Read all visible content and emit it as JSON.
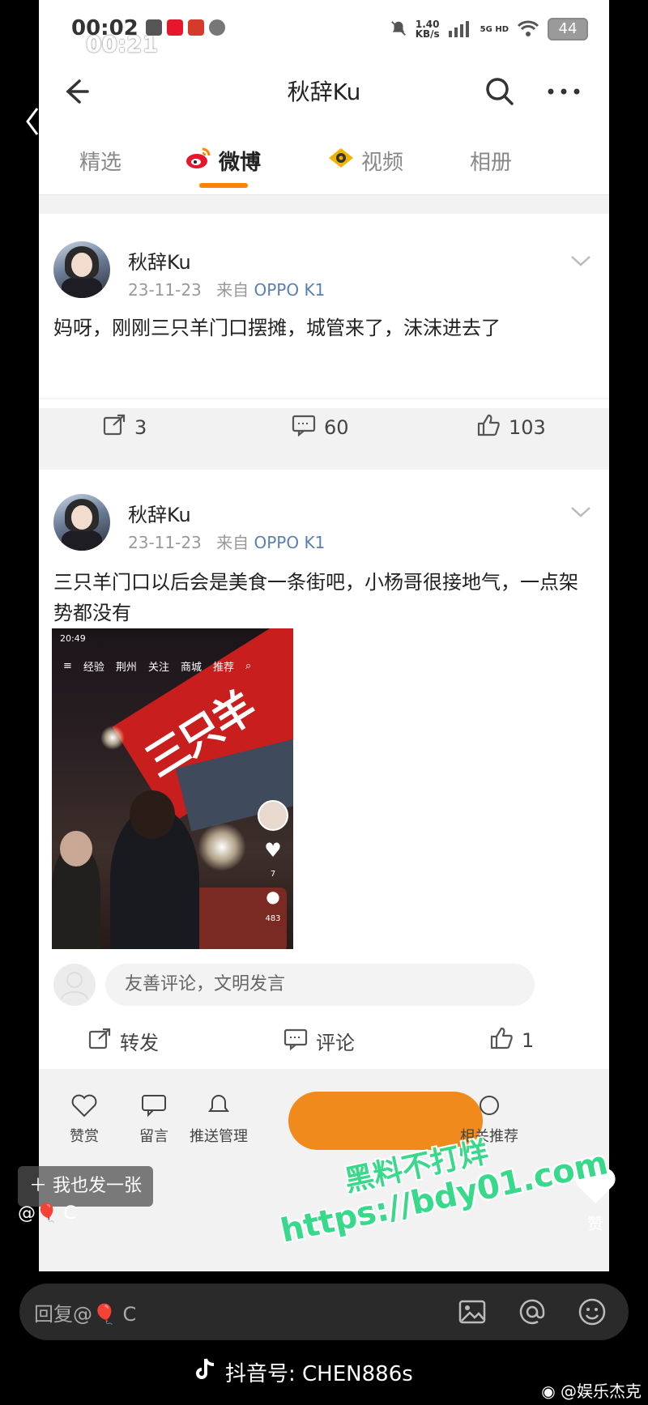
{
  "status": {
    "time_back": "00:02",
    "time_front": "00:21",
    "net_speed_value": "1.40",
    "net_speed_unit": "KB/s",
    "network": "5G HD",
    "battery": "44"
  },
  "header": {
    "title": "秋辞Ku"
  },
  "tabs": [
    {
      "label": "精选"
    },
    {
      "label": "微博"
    },
    {
      "label": "视频"
    },
    {
      "label": "相册"
    }
  ],
  "posts": [
    {
      "username": "秋辞Ku",
      "date": "23-11-23",
      "from_label": "来自",
      "source": "OPPO K1",
      "text": "妈呀，刚刚三只羊门口摆摊，城管来了，沫沫进去了",
      "repost_count": "3",
      "comment_count": "60",
      "like_count": "103"
    },
    {
      "username": "秋辞Ku",
      "date": "23-11-23",
      "from_label": "来自",
      "source": "OPPO K1",
      "text": "三只羊门口以后会是美食一条街吧，小杨哥很接地气，一点架势都没有",
      "video": {
        "time": "20:49",
        "nav": [
          "经验",
          "荆州",
          "关注",
          "商城",
          "推荐"
        ],
        "likes": "7",
        "comments": "483"
      },
      "comment_placeholder": "友善评论，文明发言",
      "repost_label": "转发",
      "comment_label": "评论",
      "like_count": "1"
    }
  ],
  "bottom_bar": {
    "items": [
      {
        "label": "赞赏"
      },
      {
        "label": "留言"
      },
      {
        "label": "推送管理"
      },
      {
        "label": "相关推荐"
      }
    ]
  },
  "overlay": {
    "post_photo_button": "我也发一张",
    "at_label": "@🎈 C",
    "like_label": "赞",
    "reply_placeholder": "回复@🎈 C",
    "tiktok_id": "抖音号: CHEN886s",
    "weibo_mark": "@娱乐杰克",
    "watermark_line1": "黑料不打烊",
    "watermark_line2": "https://bdy01.com"
  },
  "colors": {
    "weibo_orange": "#ff8200",
    "source_blue": "#5b7fb5",
    "watermark_green": "#38d98a"
  }
}
